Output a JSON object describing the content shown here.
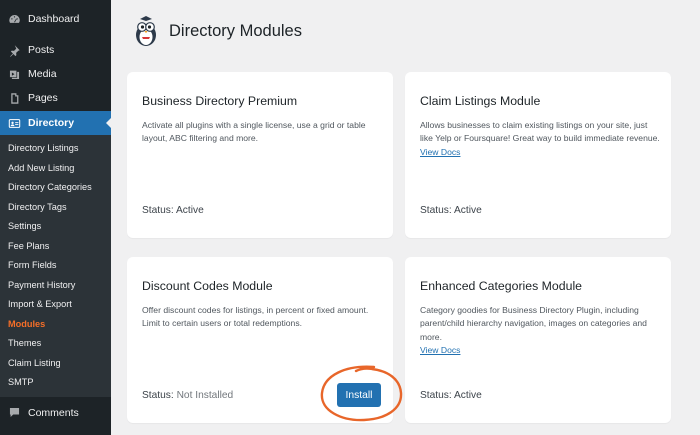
{
  "sidebar": {
    "top_items": [
      {
        "label": "Dashboard",
        "icon": "dashboard-icon"
      },
      {
        "label": "Posts",
        "icon": "pin-icon"
      },
      {
        "label": "Media",
        "icon": "media-icon"
      },
      {
        "label": "Pages",
        "icon": "pages-icon"
      }
    ],
    "active_item": {
      "label": "Directory",
      "icon": "directory-icon"
    },
    "submenu": [
      "Directory Listings",
      "Add New Listing",
      "Directory Categories",
      "Directory Tags",
      "Settings",
      "Fee Plans",
      "Form Fields",
      "Payment History",
      "Import & Export",
      "Modules",
      "Themes",
      "Claim Listing",
      "SMTP"
    ],
    "current_submenu": "Modules",
    "bottom_items": [
      {
        "label": "Comments",
        "icon": "comments-icon"
      }
    ],
    "colors": {
      "background": "#1d2327",
      "active": "#2271b1",
      "current_text": "#f56e28"
    }
  },
  "page": {
    "title": "Directory Modules"
  },
  "cards": [
    {
      "title": "Business Directory Premium",
      "description": "Activate all plugins with a single license, use a grid or table layout, ABC filtering and more.",
      "link": "",
      "status_label": "Status:",
      "status_value": "Active"
    },
    {
      "title": "Claim Listings Module",
      "description": "Allows businesses to claim existing listings on your site, just like Yelp or Foursquare! Great way to build immediate revenue.",
      "link": "View Docs",
      "status_label": "Status:",
      "status_value": "Active"
    },
    {
      "title": "Discount Codes Module",
      "description": "Offer discount codes for listings, in percent or fixed amount. Limit to certain users or total redemptions.",
      "link": "",
      "status_label": "Status:",
      "status_value": "Not Installed",
      "button": "Install"
    },
    {
      "title": "Enhanced Categories Module",
      "description": "Category goodies for Business Directory Plugin, including parent/child hierarchy navigation, images on categories and more.",
      "link": "View Docs",
      "status_label": "Status:",
      "status_value": "Active"
    }
  ],
  "annotation_color": "#e8662a"
}
